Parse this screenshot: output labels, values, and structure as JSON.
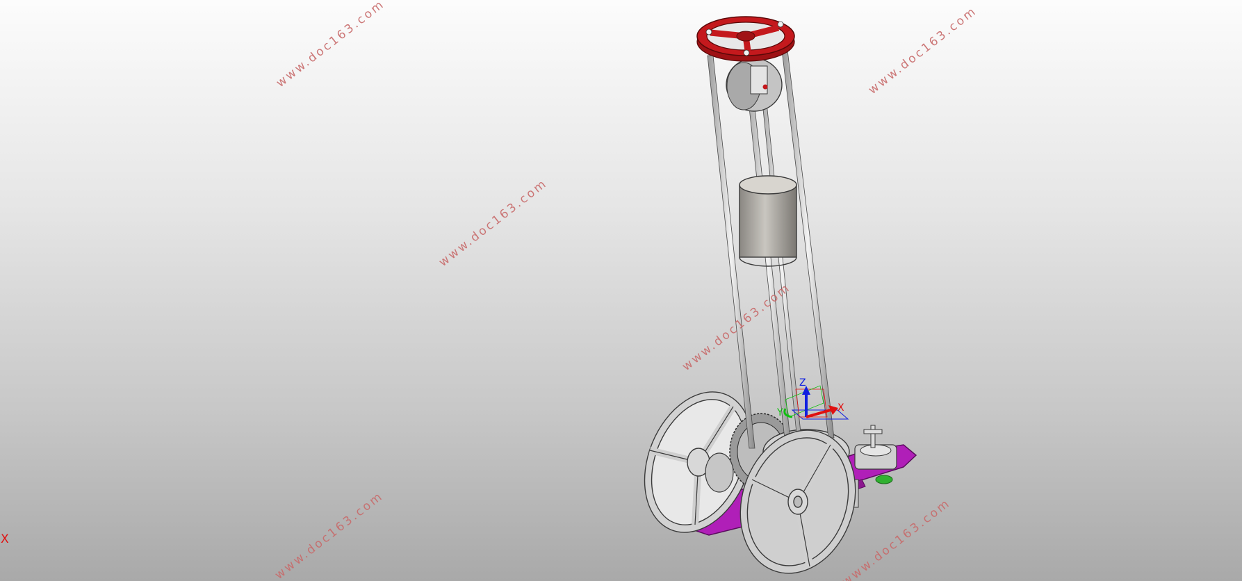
{
  "watermarks": [
    {
      "text": "www.doc163.com"
    },
    {
      "text": "www.doc163.com"
    },
    {
      "text": "www.doc163.com"
    },
    {
      "text": "www.doc163.com"
    },
    {
      "text": "www.doc163.com"
    },
    {
      "text": "www.doc163.com"
    }
  ],
  "triad": {
    "x_label": "X",
    "y_label": "Y",
    "z_label": "Z"
  },
  "corner_axis_label": "X",
  "colors": {
    "handwheel": "#c4191d",
    "base_plate": "#b01fb8",
    "parts": "#c8c8c8",
    "outline": "#3a3a3a",
    "watermark": "#c86a6a",
    "axis_x": "#e01010",
    "axis_y": "#10c010",
    "axis_z": "#1020e0"
  }
}
